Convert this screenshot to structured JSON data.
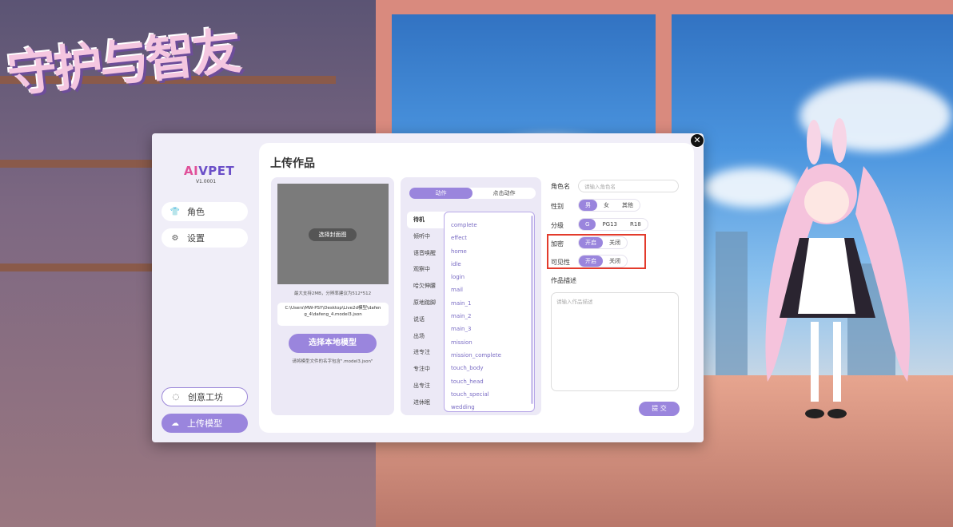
{
  "logo_art": "守护与智友",
  "brand": {
    "logo_a": "AI",
    "logo_b": "VPET",
    "version": "V1.0001"
  },
  "nav": {
    "character": "角色",
    "settings": "设置",
    "workshop": "创意工坊",
    "upload": "上传模型"
  },
  "page_title": "上传作品",
  "cover": {
    "select_cover": "选择封面图",
    "hint": "最大支持2MB，分辨率建议为512*512",
    "path": "C:\\Users\\MW-PSY\\Desktop\\Live2d模型\\dafeng_4\\dafeng_4.model3.json",
    "select_model": "选择本地模型",
    "model_hint": "请将模型文件的名字包含\".model3.json\""
  },
  "motion_tabs": [
    "动作",
    "点击动作"
  ],
  "motions": [
    "待机",
    "倾听中",
    "语音唤醒",
    "观察中",
    "哈欠伸腰",
    "原地踮脚",
    "说话",
    "出场",
    "进专注",
    "专注中",
    "出专注",
    "进休眠"
  ],
  "files": [
    "complete",
    "effect",
    "home",
    "idle",
    "login",
    "mail",
    "main_1",
    "main_2",
    "main_3",
    "mission",
    "mission_complete",
    "touch_body",
    "touch_head",
    "touch_special",
    "wedding"
  ],
  "form": {
    "name_label": "角色名",
    "name_placeholder": "请输入角色名",
    "gender_label": "性别",
    "gender_options": [
      "男",
      "女",
      "其他"
    ],
    "rating_label": "分级",
    "rating_options": [
      "G",
      "PG13",
      "R18"
    ],
    "encrypt_label": "加密",
    "visibility_label": "可见性",
    "toggle_on": "开启",
    "toggle_off": "关闭",
    "desc_label": "作品描述",
    "desc_placeholder": "请输入作品描述",
    "submit": "提 交"
  },
  "colors": {
    "accent": "#9a85dd",
    "highlight": "#e33b2c"
  }
}
